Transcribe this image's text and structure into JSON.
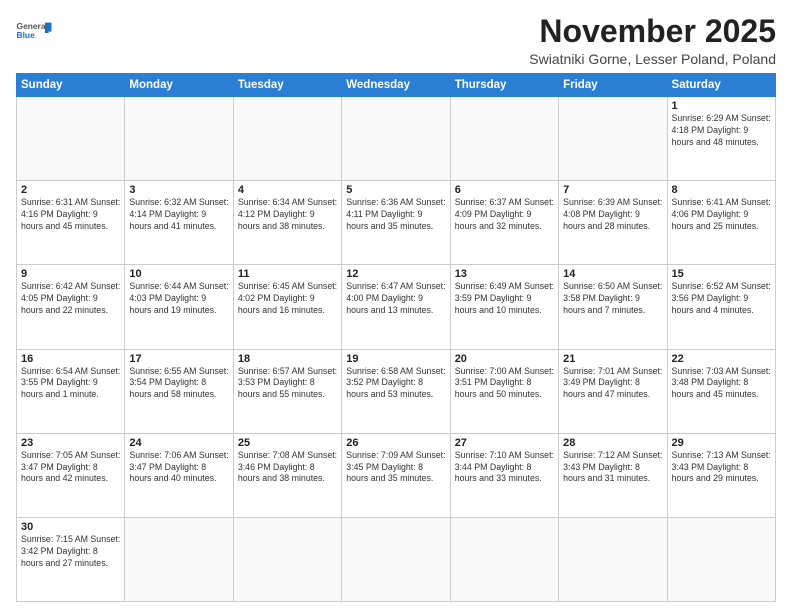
{
  "logo": {
    "line1": "General",
    "line2": "Blue"
  },
  "header": {
    "month": "November 2025",
    "location": "Swiatniki Gorne, Lesser Poland, Poland"
  },
  "weekdays": [
    "Sunday",
    "Monday",
    "Tuesday",
    "Wednesday",
    "Thursday",
    "Friday",
    "Saturday"
  ],
  "weeks": [
    [
      {
        "day": "",
        "info": ""
      },
      {
        "day": "",
        "info": ""
      },
      {
        "day": "",
        "info": ""
      },
      {
        "day": "",
        "info": ""
      },
      {
        "day": "",
        "info": ""
      },
      {
        "day": "",
        "info": ""
      },
      {
        "day": "1",
        "info": "Sunrise: 6:29 AM\nSunset: 4:18 PM\nDaylight: 9 hours\nand 48 minutes."
      }
    ],
    [
      {
        "day": "2",
        "info": "Sunrise: 6:31 AM\nSunset: 4:16 PM\nDaylight: 9 hours\nand 45 minutes."
      },
      {
        "day": "3",
        "info": "Sunrise: 6:32 AM\nSunset: 4:14 PM\nDaylight: 9 hours\nand 41 minutes."
      },
      {
        "day": "4",
        "info": "Sunrise: 6:34 AM\nSunset: 4:12 PM\nDaylight: 9 hours\nand 38 minutes."
      },
      {
        "day": "5",
        "info": "Sunrise: 6:36 AM\nSunset: 4:11 PM\nDaylight: 9 hours\nand 35 minutes."
      },
      {
        "day": "6",
        "info": "Sunrise: 6:37 AM\nSunset: 4:09 PM\nDaylight: 9 hours\nand 32 minutes."
      },
      {
        "day": "7",
        "info": "Sunrise: 6:39 AM\nSunset: 4:08 PM\nDaylight: 9 hours\nand 28 minutes."
      },
      {
        "day": "8",
        "info": "Sunrise: 6:41 AM\nSunset: 4:06 PM\nDaylight: 9 hours\nand 25 minutes."
      }
    ],
    [
      {
        "day": "9",
        "info": "Sunrise: 6:42 AM\nSunset: 4:05 PM\nDaylight: 9 hours\nand 22 minutes."
      },
      {
        "day": "10",
        "info": "Sunrise: 6:44 AM\nSunset: 4:03 PM\nDaylight: 9 hours\nand 19 minutes."
      },
      {
        "day": "11",
        "info": "Sunrise: 6:45 AM\nSunset: 4:02 PM\nDaylight: 9 hours\nand 16 minutes."
      },
      {
        "day": "12",
        "info": "Sunrise: 6:47 AM\nSunset: 4:00 PM\nDaylight: 9 hours\nand 13 minutes."
      },
      {
        "day": "13",
        "info": "Sunrise: 6:49 AM\nSunset: 3:59 PM\nDaylight: 9 hours\nand 10 minutes."
      },
      {
        "day": "14",
        "info": "Sunrise: 6:50 AM\nSunset: 3:58 PM\nDaylight: 9 hours\nand 7 minutes."
      },
      {
        "day": "15",
        "info": "Sunrise: 6:52 AM\nSunset: 3:56 PM\nDaylight: 9 hours\nand 4 minutes."
      }
    ],
    [
      {
        "day": "16",
        "info": "Sunrise: 6:54 AM\nSunset: 3:55 PM\nDaylight: 9 hours\nand 1 minute."
      },
      {
        "day": "17",
        "info": "Sunrise: 6:55 AM\nSunset: 3:54 PM\nDaylight: 8 hours\nand 58 minutes."
      },
      {
        "day": "18",
        "info": "Sunrise: 6:57 AM\nSunset: 3:53 PM\nDaylight: 8 hours\nand 55 minutes."
      },
      {
        "day": "19",
        "info": "Sunrise: 6:58 AM\nSunset: 3:52 PM\nDaylight: 8 hours\nand 53 minutes."
      },
      {
        "day": "20",
        "info": "Sunrise: 7:00 AM\nSunset: 3:51 PM\nDaylight: 8 hours\nand 50 minutes."
      },
      {
        "day": "21",
        "info": "Sunrise: 7:01 AM\nSunset: 3:49 PM\nDaylight: 8 hours\nand 47 minutes."
      },
      {
        "day": "22",
        "info": "Sunrise: 7:03 AM\nSunset: 3:48 PM\nDaylight: 8 hours\nand 45 minutes."
      }
    ],
    [
      {
        "day": "23",
        "info": "Sunrise: 7:05 AM\nSunset: 3:47 PM\nDaylight: 8 hours\nand 42 minutes."
      },
      {
        "day": "24",
        "info": "Sunrise: 7:06 AM\nSunset: 3:47 PM\nDaylight: 8 hours\nand 40 minutes."
      },
      {
        "day": "25",
        "info": "Sunrise: 7:08 AM\nSunset: 3:46 PM\nDaylight: 8 hours\nand 38 minutes."
      },
      {
        "day": "26",
        "info": "Sunrise: 7:09 AM\nSunset: 3:45 PM\nDaylight: 8 hours\nand 35 minutes."
      },
      {
        "day": "27",
        "info": "Sunrise: 7:10 AM\nSunset: 3:44 PM\nDaylight: 8 hours\nand 33 minutes."
      },
      {
        "day": "28",
        "info": "Sunrise: 7:12 AM\nSunset: 3:43 PM\nDaylight: 8 hours\nand 31 minutes."
      },
      {
        "day": "29",
        "info": "Sunrise: 7:13 AM\nSunset: 3:43 PM\nDaylight: 8 hours\nand 29 minutes."
      }
    ],
    [
      {
        "day": "30",
        "info": "Sunrise: 7:15 AM\nSunset: 3:42 PM\nDaylight: 8 hours\nand 27 minutes."
      },
      {
        "day": "",
        "info": ""
      },
      {
        "day": "",
        "info": ""
      },
      {
        "day": "",
        "info": ""
      },
      {
        "day": "",
        "info": ""
      },
      {
        "day": "",
        "info": ""
      },
      {
        "day": "",
        "info": ""
      }
    ]
  ]
}
